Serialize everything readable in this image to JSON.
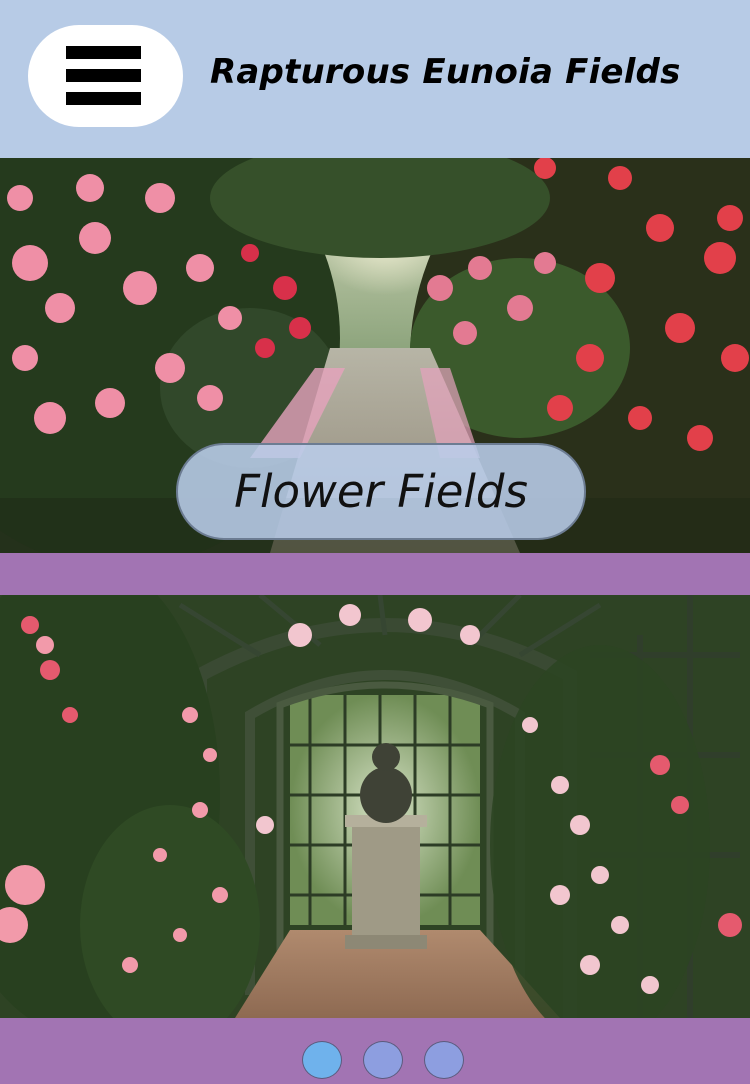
{
  "header": {
    "title": "Rapturous Eunoia Fields",
    "menu_icon": "hamburger-menu-icon"
  },
  "slides": [
    {
      "caption": "Flower Fields",
      "image": "rose garden path with arbor"
    },
    {
      "image": "rose covered pergola walkway with statue"
    }
  ],
  "carousel": {
    "dot_count": 3,
    "active_index": 0
  },
  "colors": {
    "header_bg": "#b7cbe6",
    "accent_purple": "#a274b3",
    "dot_active": "#6fb2ec",
    "dot_inactive": "#8d9ee0"
  }
}
